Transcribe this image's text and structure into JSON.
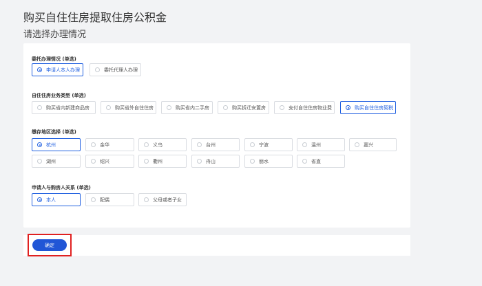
{
  "header": {
    "title": "购买自住住房提取住房公积金",
    "subtitle": "请选择办理情况"
  },
  "sections": {
    "delegate": {
      "label": "委托办理情况 (单选)",
      "options": [
        "申请人本人办理",
        "委托代理人办理"
      ],
      "selected": "申请人本人办理"
    },
    "business_type": {
      "label": "自住住房业务类型 (单选)",
      "options": [
        "购买省内新建商品房",
        "购买省外自住住房",
        "购买省内二手房",
        "购买拆迁安置房",
        "支付自住住房物业费",
        "购买自住住房契税"
      ],
      "selected": "购买自住住房契税"
    },
    "region": {
      "label": "缴存地区选择 (单选)",
      "options": [
        "杭州",
        "金华",
        "义乌",
        "台州",
        "宁波",
        "温州",
        "嘉兴",
        "湖州",
        "绍兴",
        "衢州",
        "舟山",
        "丽水",
        "省直"
      ],
      "selected": "杭州"
    },
    "relation": {
      "label": "申请人与购房人关系 (单选)",
      "options": [
        "本人",
        "配偶",
        "父母或者子女"
      ],
      "selected": "本人"
    }
  },
  "footer": {
    "confirm_label": "确定"
  },
  "colors": {
    "accent": "#1f5fe0",
    "highlight": "#e02020",
    "background": "#f2f3f5"
  }
}
